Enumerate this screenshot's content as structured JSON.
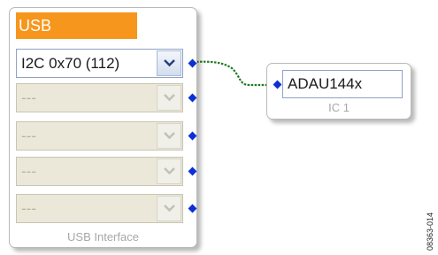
{
  "usb_block": {
    "title": "USB",
    "selected_address": "I2C 0x70 (112)",
    "empty_slots": [
      "---",
      "---",
      "---",
      "---"
    ],
    "footer": "USB Interface"
  },
  "ic_block": {
    "part_name": "ADAU144x",
    "footer": "IC 1"
  },
  "figure_code": "08363-014",
  "colors": {
    "title_bar": "#f7961c",
    "port": "#0d2fd6",
    "wire": "#1f7a1f"
  }
}
